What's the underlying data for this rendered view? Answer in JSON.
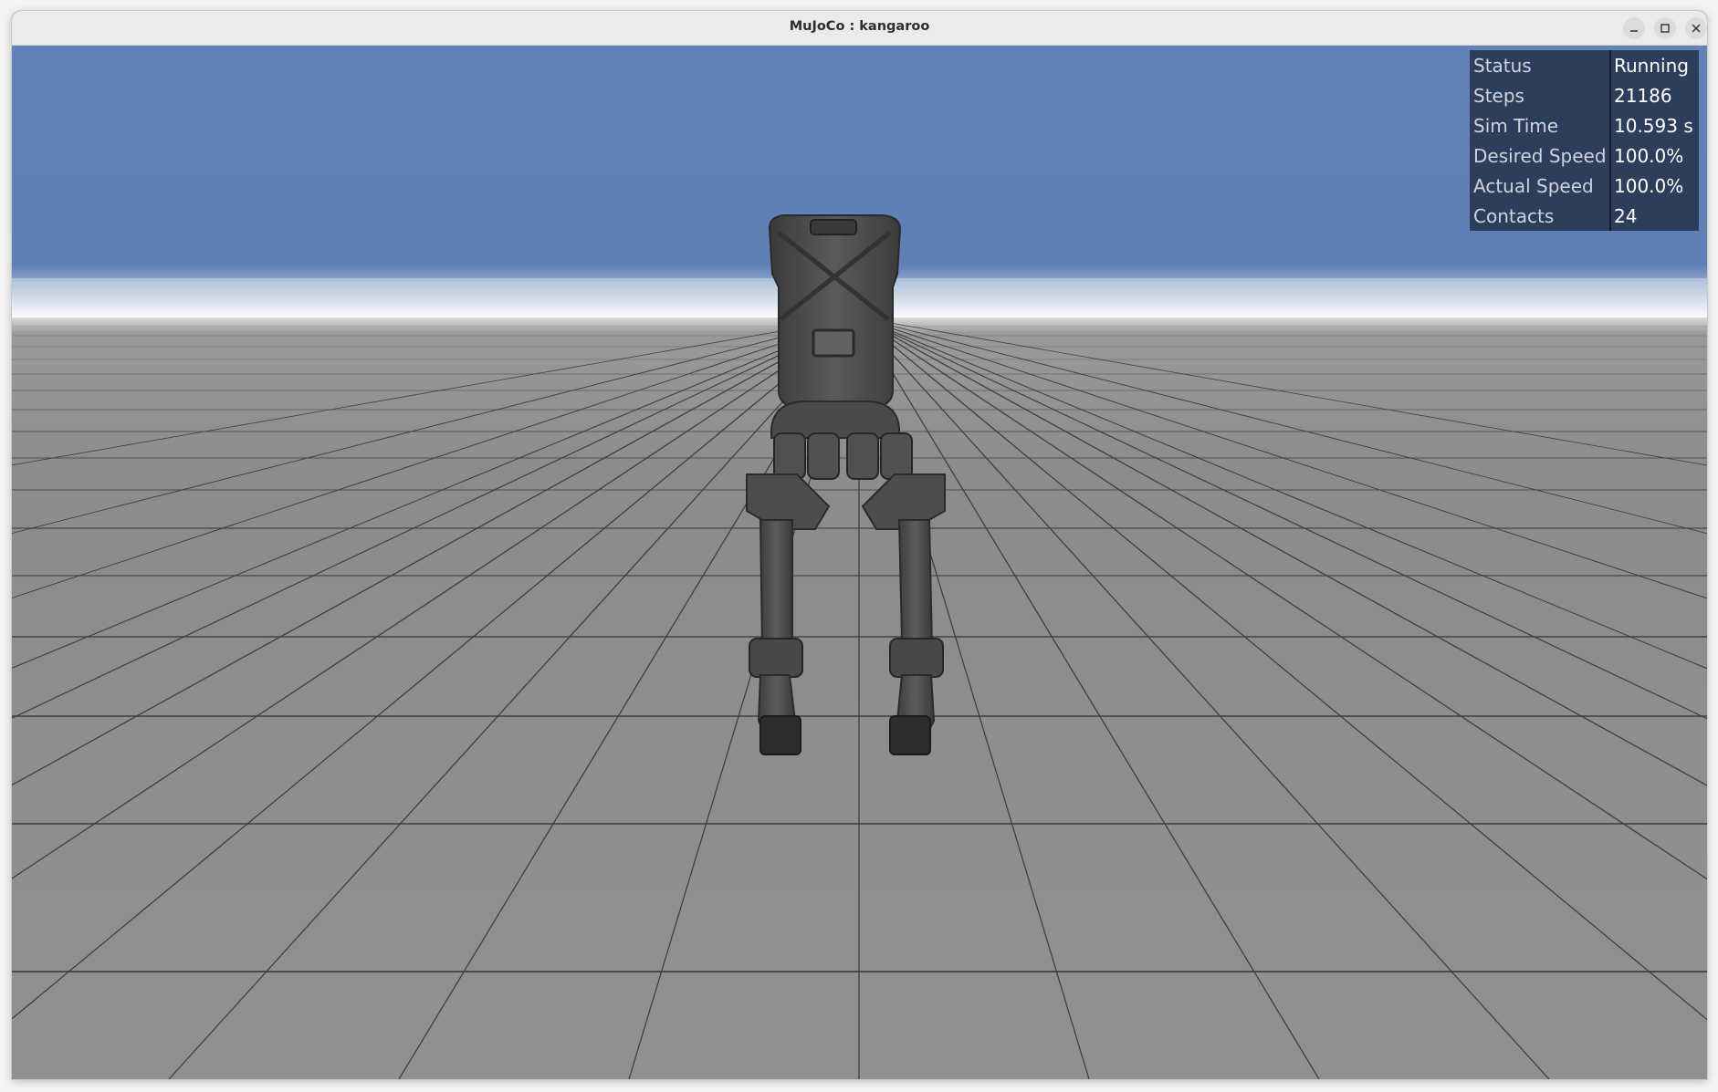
{
  "window": {
    "title": "MuJoCo : kangaroo",
    "controls": {
      "minimize_icon": "minimize-icon",
      "maximize_icon": "maximize-icon",
      "close_icon": "close-icon"
    }
  },
  "viewport": {
    "sky_color": "#6283b7",
    "floor_color": "#8e8e8e",
    "grid_color": "#3c3c3c",
    "robot_color": "#4a4a4a",
    "model_name": "kangaroo"
  },
  "info_panel": {
    "rows": [
      {
        "label": "Status",
        "value": "Running"
      },
      {
        "label": "Steps",
        "value": "21186"
      },
      {
        "label": "Sim Time",
        "value": "10.593 s"
      },
      {
        "label": "Desired Speed",
        "value": "100.0%"
      },
      {
        "label": "Actual Speed",
        "value": "100.0%"
      },
      {
        "label": "Contacts",
        "value": "24"
      }
    ]
  }
}
